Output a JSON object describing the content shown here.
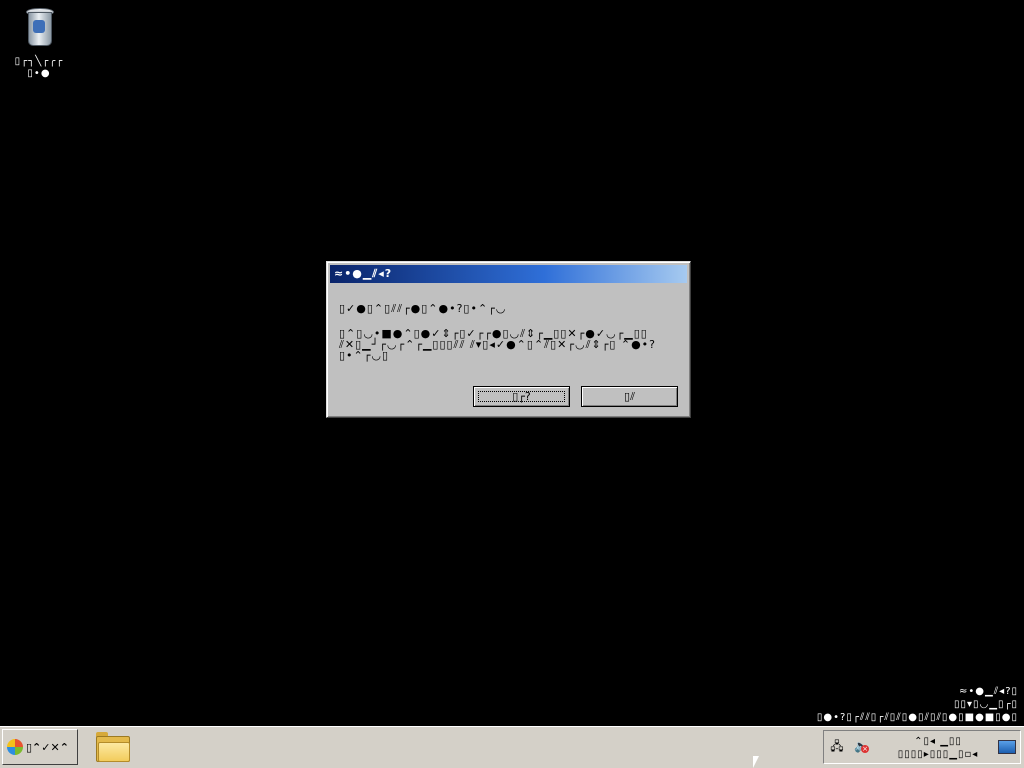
{
  "desktop": {
    "recycle_bin_label_line1": "▯┌┐╲┌╭┌",
    "recycle_bin_label_line2": "▯•●"
  },
  "dialog": {
    "title": "≈•●▁⫽◂?",
    "message_line1": "▯✓●▯⌃▯⫽⫽┌●▯⌃●•?▯•⌃┌◡",
    "message_body": "▯⌃▯◡•■●⌃▯●✓⇕┌▯✓┌┌●▯◡⫽⇕┌▁▯▯✕┌●✓◡┌▁▯▯ ⫽✕▯▁┘┌◡┌⌃┌▁▯▯▯⫽⫽ ⫽▾▯◂✓●⌃▯⌃⫽▯✕┌◡⫽⇕┌▯ ⌃●•?▯•⌃┌◡▯",
    "yes_button": "▯┌?",
    "no_button": "▯⫽"
  },
  "watermark": {
    "line1": "≈•●▁⫽◂?▯",
    "line2": "▯▯▾▯◡▁▯┌▯",
    "line3": "▯●•?▯┌⫽⫽▯┌⫽▯⫽▯●▯⫽▯⫽▯●▯■●■▯●▯"
  },
  "taskbar": {
    "start_label": "▯⌃✓✕⌃",
    "clock_line1": "⌃▯◂ ▁▯▯",
    "clock_line2": "▯▯▯▯▸▯▯▯▁▯▫◂"
  }
}
